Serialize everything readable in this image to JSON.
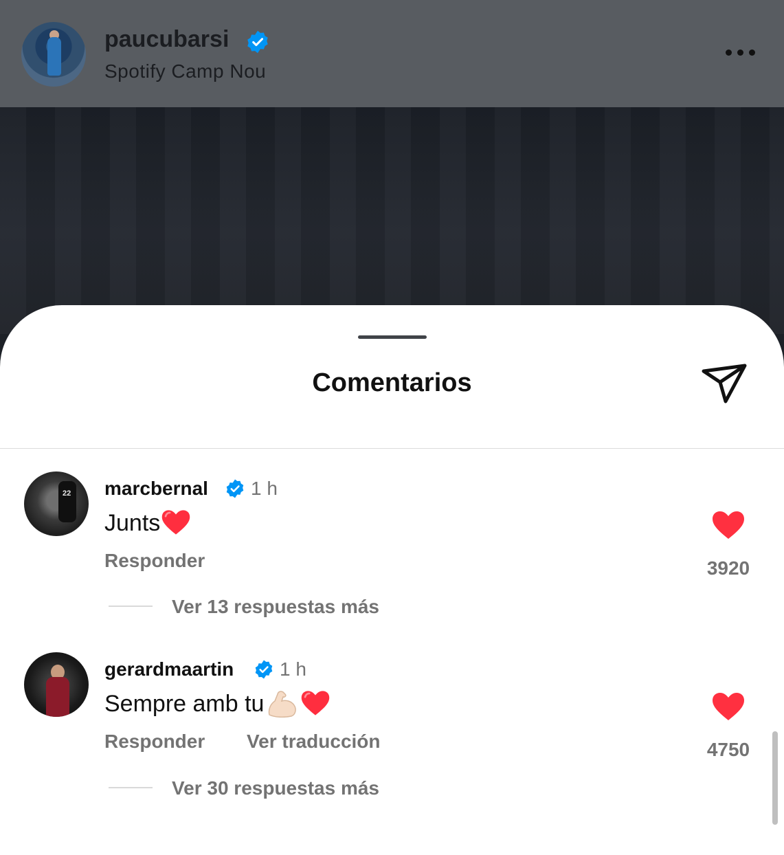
{
  "post": {
    "username": "paucubarsi",
    "location": "Spotify Camp Nou",
    "verified_icon": "verified-badge-icon",
    "more_icon": "more-horizontal-icon"
  },
  "sheet": {
    "title": "Comentarios",
    "share_icon": "send-icon"
  },
  "comments": [
    {
      "username": "marcbernal",
      "time": "1 h",
      "text": "Junts",
      "emoji": [
        "red-heart"
      ],
      "reply_label": "Responder",
      "likes": "3920",
      "view_replies": "Ver 13 respuestas más"
    },
    {
      "username": "gerardmaartin",
      "time": "1 h",
      "text": "Sempre amb tu",
      "emoji": [
        "flexed-biceps",
        "red-heart"
      ],
      "reply_label": "Responder",
      "translate_label": "Ver traducción",
      "likes": "4750",
      "view_replies": "Ver 30 respuestas más"
    }
  ],
  "colors": {
    "header_bg": "#585c61",
    "like_red": "#ff3040",
    "verified_blue": "#0095f6",
    "secondary_text": "#737373"
  }
}
